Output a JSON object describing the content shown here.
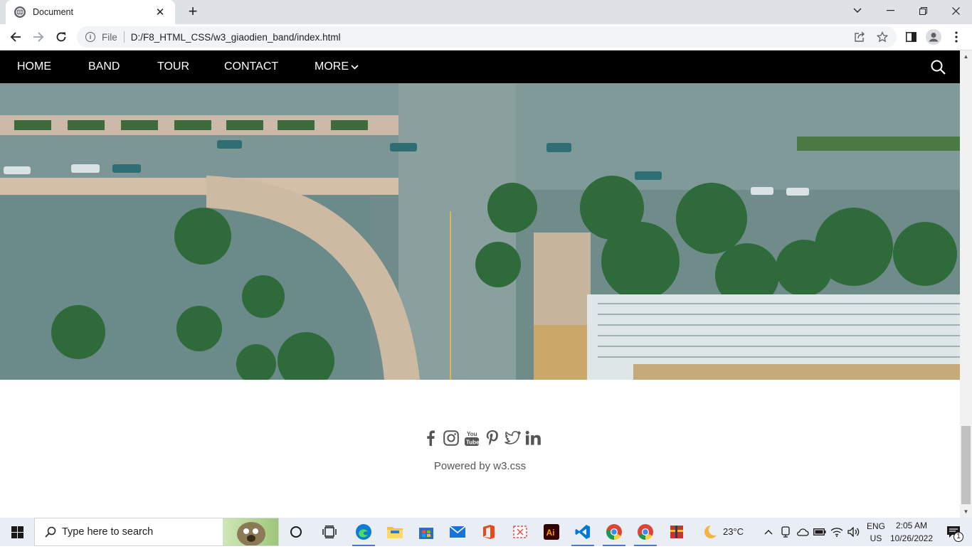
{
  "browser": {
    "tab_title": "Document",
    "tab_close": "✕",
    "new_tab": "+",
    "window_controls": {
      "minimize": "—",
      "restore": "❐",
      "close": "✕",
      "tab_search": "⌄"
    },
    "address": {
      "scheme_label": "File",
      "url": "D:/F8_HTML_CSS/w3_giaodien_band/index.html"
    }
  },
  "nav": {
    "items": [
      "HOME",
      "BAND",
      "TOUR",
      "CONTACT",
      "MORE"
    ],
    "more_chevron": "⌄",
    "search_icon": "search-icon"
  },
  "hero": {
    "description_icon": "aerial-city-photo"
  },
  "footer": {
    "social_icons": [
      "facebook-icon",
      "instagram-icon",
      "youtube-icon",
      "pinterest-icon",
      "twitter-icon",
      "linkedin-icon"
    ],
    "powered_by": "Powered by w3.css"
  },
  "taskbar": {
    "search_placeholder": "Type here to search",
    "weather": "23°C",
    "language_top": "ENG",
    "language_bottom": "US",
    "time": "2:05 AM",
    "date": "10/26/2022",
    "notification_count": "1",
    "colors": {
      "accent": "#3f7bd6",
      "edge": "#0c7cd5",
      "office": "#e64a19",
      "illustrator": "#ff9a00",
      "vscode": "#0078d4"
    }
  }
}
